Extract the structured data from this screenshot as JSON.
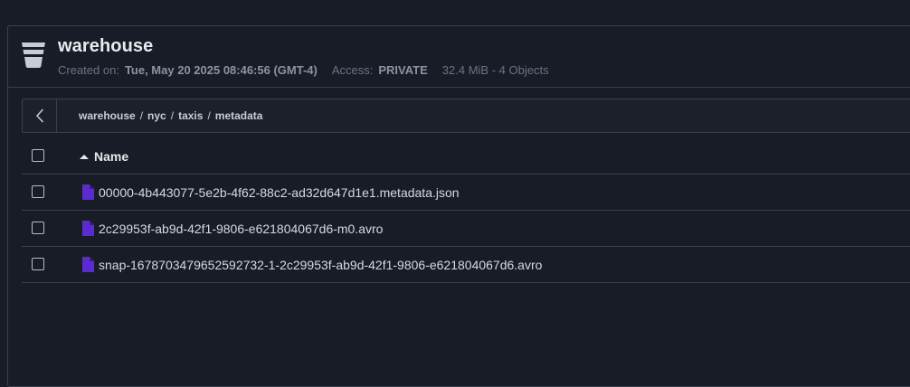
{
  "bucket": {
    "icon": "bucket-icon",
    "name": "warehouse",
    "created_label": "Created on:",
    "created_value": "Tue, May 20 2025 08:46:56 (GMT-4)",
    "access_label": "Access:",
    "access_value": "PRIVATE",
    "size_summary": "32.4 MiB - 4 Objects"
  },
  "breadcrumb": {
    "back_icon": "chevron-left-icon",
    "segments": [
      "warehouse",
      "nyc",
      "taxis",
      "metadata"
    ],
    "separator": "/"
  },
  "table": {
    "name_header": "Name",
    "sort_icon": "sort-ascending-icon",
    "file_icon": "file-icon",
    "rows": [
      {
        "name": "00000-4b443077-5e2b-4f62-88c2-ad32d647d1e1.metadata.json"
      },
      {
        "name": "2c29953f-ab9d-42f1-9806-e621804067d6-m0.avro"
      },
      {
        "name": "snap-1678703479652592732-1-2c29953f-ab9d-42f1-9806-e621804067d6.avro"
      }
    ]
  },
  "colors": {
    "background": "#181c26",
    "border": "#3a404c",
    "file_icon": "#5b2bd1"
  }
}
